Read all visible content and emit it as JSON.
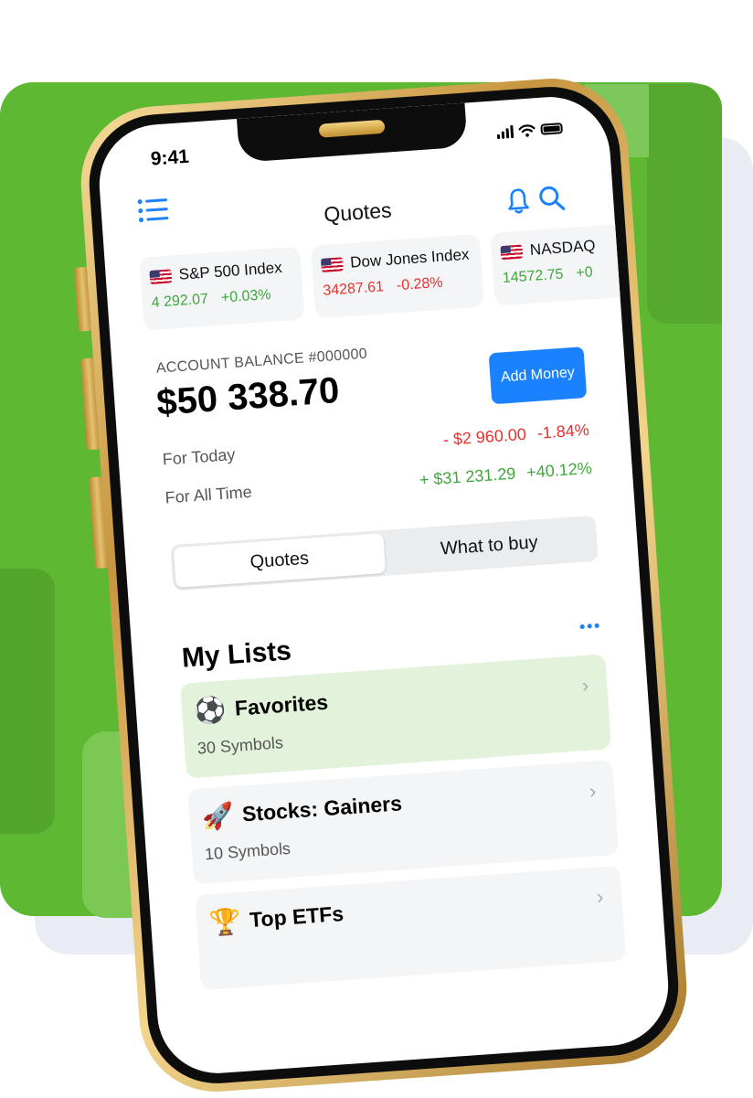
{
  "status": {
    "time": "9:41"
  },
  "header": {
    "title": "Quotes"
  },
  "indices": [
    {
      "name": "S&P 500 Index",
      "value": "4 292.07",
      "change": "+0.03%",
      "trend": "up"
    },
    {
      "name": "Dow Jones Index",
      "value": "34287.61",
      "change": "-0.28%",
      "trend": "down"
    },
    {
      "name": "NASDAQ",
      "value": "14572.75",
      "change": "+0",
      "trend": "up"
    }
  ],
  "account": {
    "label": "ACCOUNT BALANCE #000000",
    "balance": "$50 338.70",
    "add_money": "Add Money",
    "today_label": "For Today",
    "today_amount": "- $2 960.00",
    "today_pct": "-1.84%",
    "alltime_label": "For All Time",
    "alltime_amount": "+ $31 231.29",
    "alltime_pct": "+40.12%"
  },
  "tabs": {
    "quotes": "Quotes",
    "what_to_buy": "What to buy",
    "active": "quotes"
  },
  "lists": {
    "title": "My Lists",
    "items": [
      {
        "name": "Favorites",
        "count": "30 Symbols",
        "icon": "soccer-ball-icon",
        "emoji": "⚽"
      },
      {
        "name": "Stocks: Gainers",
        "count": "10 Symbols",
        "icon": "rocket-icon",
        "emoji": "🚀"
      },
      {
        "name": "Top ETFs",
        "count": "",
        "icon": "trophy-icon",
        "emoji": "🏆"
      }
    ]
  },
  "colors": {
    "brand_green": "#5fb832",
    "accent_blue": "#1a82ff",
    "gain": "#3ea83a",
    "loss": "#e8312f"
  }
}
